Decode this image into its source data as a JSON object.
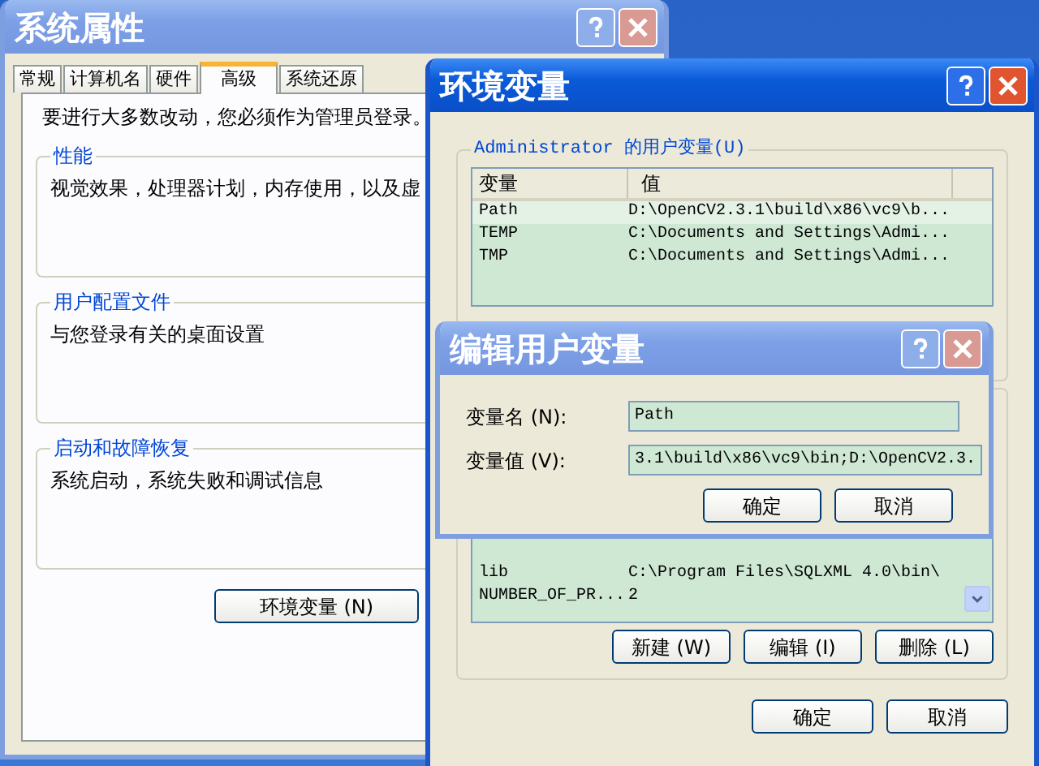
{
  "system_properties": {
    "title": "系统属性",
    "tabs": [
      {
        "label": "常规",
        "selected": false
      },
      {
        "label": "计算机名",
        "selected": false
      },
      {
        "label": "硬件",
        "selected": false
      },
      {
        "label": "高级",
        "selected": true
      },
      {
        "label": "系统还原",
        "selected": false
      }
    ],
    "notice": "要进行大多数改动，您必须作为管理员登录。",
    "groups": [
      {
        "title": "性能",
        "description": "视觉效果，处理器计划，内存使用，以及虚"
      },
      {
        "title": "用户配置文件",
        "description": "与您登录有关的桌面设置"
      },
      {
        "title": "启动和故障恢复",
        "description": "系统启动，系统失败和调试信息"
      }
    ],
    "buttons": [
      "环境变量 (N)"
    ]
  },
  "environment_variables": {
    "title": "环境变量",
    "user_group": {
      "title": "Administrator 的用户变量(U)",
      "columns": [
        "变量",
        "值"
      ],
      "rows": [
        {
          "name": "Path",
          "value": "D:\\OpenCV2.3.1\\build\\x86\\vc9\\b...",
          "selected": true
        },
        {
          "name": "TEMP",
          "value": "C:\\Documents and Settings\\Admi...",
          "selected": false
        },
        {
          "name": "TMP",
          "value": "C:\\Documents and Settings\\Admi...",
          "selected": false
        }
      ]
    },
    "system_rows": [
      {
        "name": "lib",
        "value": "C:\\Program Files\\SQLXML 4.0\\bin\\"
      },
      {
        "name": "NUMBER_OF_PR...",
        "value": "2"
      }
    ],
    "system_buttons": [
      "新建 (W)",
      "编辑 (I)",
      "删除 (L)"
    ],
    "buttons": [
      "确定",
      "取消"
    ]
  },
  "edit_dialog": {
    "title": "编辑用户变量",
    "fields": [
      {
        "label": "变量名 (N):",
        "value": "Path"
      },
      {
        "label": "变量值 (V):",
        "value": "3.1\\build\\x86\\vc9\\bin;D:\\OpenCV2.3."
      }
    ],
    "buttons": [
      "确定",
      "取消"
    ]
  }
}
